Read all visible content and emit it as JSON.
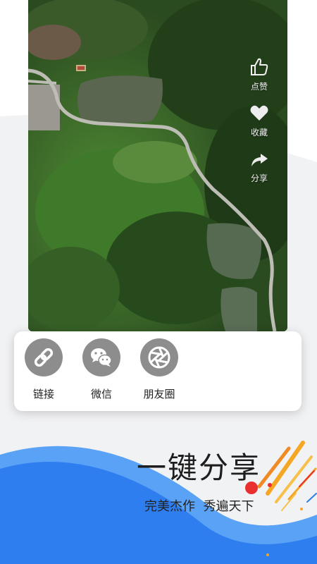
{
  "colors": {
    "wave_blue": "#2f7ef0",
    "wave_blue_light": "#59a2f6",
    "icon_grey": "#8d8d8d",
    "accent_orange": "#f5a623",
    "accent_red": "#e8302f"
  },
  "side_actions": [
    {
      "icon": "thumbs-up-icon",
      "label": "点赞"
    },
    {
      "icon": "heart-icon",
      "label": "收藏"
    },
    {
      "icon": "share-arrow-icon",
      "label": "分享"
    }
  ],
  "share_sheet": {
    "options": [
      {
        "icon": "link-icon",
        "label": "链接"
      },
      {
        "icon": "wechat-icon",
        "label": "微信"
      },
      {
        "icon": "moments-icon",
        "label": "朋友圈"
      }
    ]
  },
  "promo": {
    "title": "一键分享",
    "subtitle": "完美杰作  秀遍天下"
  }
}
